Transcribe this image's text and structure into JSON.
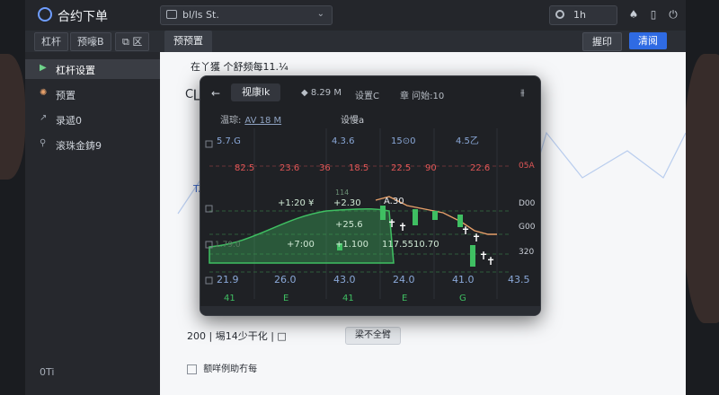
{
  "app": {
    "title": "合约下单",
    "file_select": "bl/ls St.",
    "search_value": "1h"
  },
  "toolbar": {
    "lever_label": "杠杆",
    "preset_label": "预嚎B",
    "tab_label": "预预置",
    "cancel_label": "握印",
    "confirm_label": "清阅"
  },
  "sidebar": {
    "items": [
      {
        "icon": "play-icon",
        "label": "杠杆设置"
      },
      {
        "icon": "gear-icon",
        "label": "预置"
      },
      {
        "icon": "trend-icon",
        "label": "录遞0"
      },
      {
        "icon": "pin-icon",
        "label": "滚珠金鋳9"
      }
    ],
    "footer": "0Ti"
  },
  "doc": {
    "line1": "在丫獲 个舒频每11.¼",
    "heading": "C∐",
    "side_mark": "TA",
    "bottom_text": "200 | 埸14少干化 | □",
    "pill": "梁不全臂",
    "check_label": "额咩例助冇每"
  },
  "modal": {
    "back_glyph": "←",
    "tab": "视康lk",
    "price_meta": "8.29 M",
    "settings_meta": "设置C",
    "time_meta": "章 问始:10",
    "row2_label": "温琮:",
    "row2_link": "AV 18 M",
    "row2_right": "设慢a",
    "top_labels": [
      "5.7.G",
      "4.3.6",
      "15⊙0",
      "4.5乙"
    ],
    "price_labels": [
      "82.5",
      "23.6",
      "36",
      "18.5",
      "22.5",
      "90",
      "22.6"
    ],
    "right_axis": [
      "05A",
      "D00",
      "G00",
      "320"
    ],
    "mid_labels": [
      "+1:20 ¥",
      "+2.30",
      "A.30",
      "+25.6",
      "+7:00",
      "+1.100",
      "117.5510.70"
    ],
    "small_label": "114",
    "left_small": "1.79.0",
    "bottom_values": [
      "21.9",
      "26.0",
      "43.0",
      "24.0",
      "41.0",
      "43.5"
    ],
    "bottom_letters": [
      "41",
      "E",
      "41",
      "E",
      "G"
    ],
    "colors": {
      "green": "#3fbf62",
      "red": "#e05656",
      "orange": "#e7a06a",
      "bg": "#1f2125"
    }
  }
}
